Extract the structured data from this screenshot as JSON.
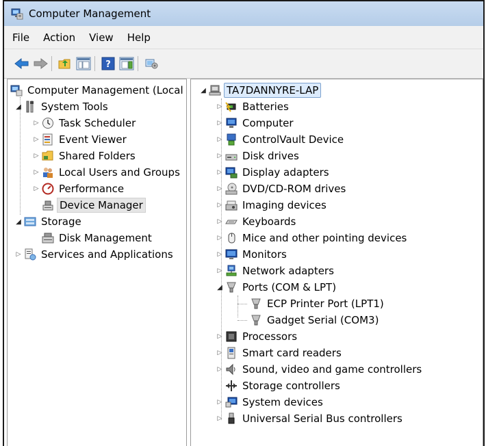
{
  "window": {
    "title": "Computer Management"
  },
  "menu": [
    "File",
    "Action",
    "View",
    "Help"
  ],
  "toolbar": {
    "buttons": [
      "back-arrow-icon",
      "forward-arrow-icon",
      "up-folder-icon",
      "show-hide-tree-icon",
      "help-icon",
      "action-pane-icon",
      "properties-icon"
    ]
  },
  "left_tree": {
    "root": "Computer Management (Local",
    "system_tools": "System Tools",
    "task_scheduler": "Task Scheduler",
    "event_viewer": "Event Viewer",
    "shared_folders": "Shared Folders",
    "local_users": "Local Users and Groups",
    "performance": "Performance",
    "device_manager": "Device Manager",
    "storage": "Storage",
    "disk_management": "Disk Management",
    "services": "Services and Applications"
  },
  "device_tree": {
    "computer_name": "TA7DANNYRE-LAP",
    "categories": [
      "Batteries",
      "Computer",
      "ControlVault Device",
      "Disk drives",
      "Display adapters",
      "DVD/CD-ROM drives",
      "Imaging devices",
      "Keyboards",
      "Mice and other pointing devices",
      "Monitors",
      "Network adapters",
      "Ports (COM & LPT)"
    ],
    "ports_children": [
      "ECP Printer Port (LPT1)",
      "Gadget Serial (COM3)"
    ],
    "categories_after": [
      "Processors",
      "Smart card readers",
      "Sound, video and game controllers",
      "Storage controllers",
      "System devices",
      "Universal Serial Bus controllers"
    ]
  }
}
